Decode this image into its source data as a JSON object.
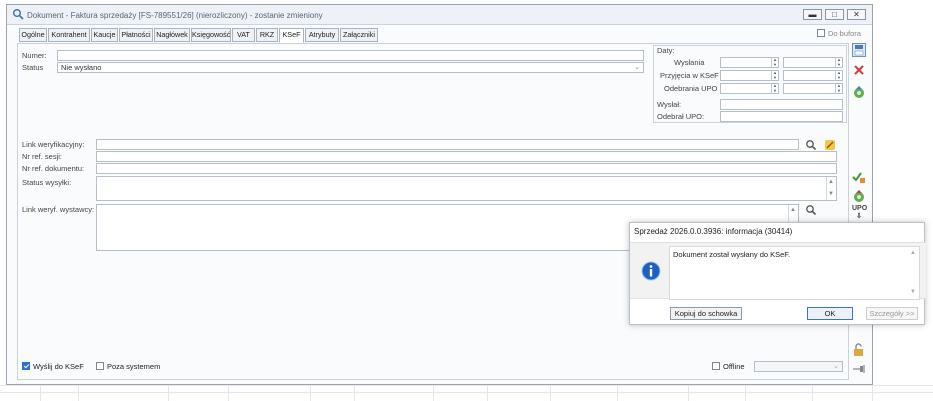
{
  "window": {
    "title": "Dokument - Faktura sprzedaży [FS-789551/26] (nierozliczony) - zostanie zmieniony"
  },
  "tabs": [
    {
      "label": "Ogólne"
    },
    {
      "label": "Kontrahent"
    },
    {
      "label": "Kaucje"
    },
    {
      "label": "Płatności"
    },
    {
      "label": "Nagłówek"
    },
    {
      "label": "Księgowość"
    },
    {
      "label": "VAT"
    },
    {
      "label": "RKZ"
    },
    {
      "label": "KSeF"
    },
    {
      "label": "Atrybuty"
    },
    {
      "label": "Załączniki"
    }
  ],
  "active_tab": "KSeF",
  "do_bufora": {
    "label": "Do bufora",
    "checked": false
  },
  "form": {
    "numer_label": "Numer:",
    "numer_value": "",
    "status_label": "Status",
    "status_value": "Nie wysłano",
    "link_weryfikacyjny_label": "Link weryfikacyjny:",
    "nr_ref_sesji_label": "Nr ref. sesji:",
    "nr_ref_dokumentu_label": "Nr ref. dokumentu:",
    "status_wysylki_label": "Status wysyłki:",
    "link_weryf_wystawcy_label": "Link weryf. wystawcy:"
  },
  "daty": {
    "title": "Daty:",
    "rows": [
      {
        "label": "Wysłania"
      },
      {
        "label": "Przyjęcia w KSeF"
      },
      {
        "label": "Odebrania UPO"
      }
    ],
    "wyslal_label": "Wysłał:",
    "odebral_label": "Odebrał UPO:"
  },
  "bottom": {
    "wyslij_label": "Wyślij do KSeF",
    "wyslij_checked": true,
    "poza_label": "Poza systemem",
    "poza_checked": false,
    "offline_label": "Offline",
    "offline_checked": false
  },
  "sidebar_icons": {
    "upo_label": "UPO"
  },
  "dialog": {
    "title": "Sprzedaż 2026.0.0.3936: informacja (30414)",
    "message": "Dokument został wysłany do KSeF.",
    "copy_button": "Kopiuj do schowka",
    "ok_button": "OK",
    "details_button": "Szczegóły >>"
  },
  "colors": {
    "accent": "#2f6fd0",
    "close_red": "#d23b3b",
    "info_blue": "#1f5fbf"
  }
}
